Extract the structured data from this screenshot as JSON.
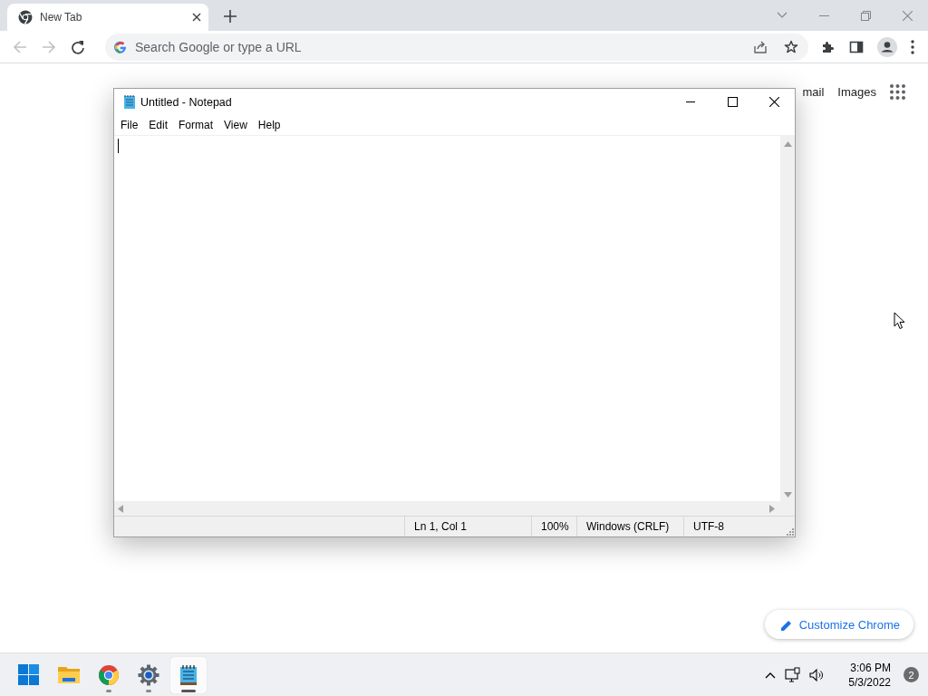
{
  "browser": {
    "tabs": [
      {
        "title": "New Tab",
        "selected": true
      }
    ],
    "navigation": {
      "back_disabled": true,
      "forward_disabled": true
    },
    "address_bar": {
      "placeholder": "Search Google or type a URL"
    }
  },
  "new_tab_page": {
    "links": [
      "mail",
      "Images"
    ],
    "customize_button": "Customize Chrome"
  },
  "notepad": {
    "title": "Untitled - Notepad",
    "menu": [
      "File",
      "Edit",
      "Format",
      "View",
      "Help"
    ],
    "status_bar": [
      "Ln 1, Col 1",
      "100%",
      "Windows (CRLF)",
      "UTF-8"
    ]
  },
  "taskbar": {
    "apps": [
      {
        "kind": "start",
        "running": false,
        "selected": false
      },
      {
        "kind": "explorer",
        "running": false,
        "selected": false
      },
      {
        "kind": "chrome",
        "running": true,
        "selected": false
      },
      {
        "kind": "settings",
        "running": true,
        "selected": false
      },
      {
        "kind": "notepad",
        "running": true,
        "selected": true
      }
    ],
    "clock": {
      "time": "3:06 PM",
      "date": "5/3/2022"
    },
    "notification_count": "2"
  }
}
